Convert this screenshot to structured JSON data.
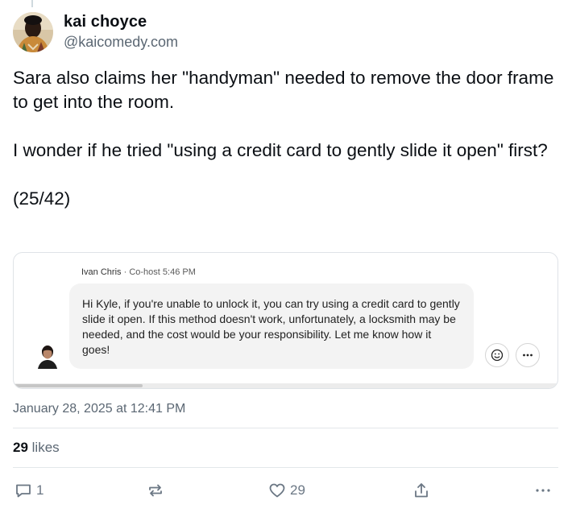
{
  "author": {
    "name": "kai choyce",
    "handle": "@kaicomedy.com"
  },
  "post": {
    "paragraph1": "Sara also claims her \"handyman\" needed to remove the door frame to get into the room.",
    "paragraph2": "I wonder if he tried \"using a credit card to gently slide it open\" first?",
    "paragraph3": "(25/42)"
  },
  "embed": {
    "author": "Ivan Chris",
    "role": "· Co-host",
    "time": "5:46 PM",
    "message": "Hi Kyle, if you're unable to unlock it, you can try using a credit card to gently slide it open. If this method doesn't work, unfortunately, a locksmith may be needed, and the cost would be your responsibility. Let me know how it goes!",
    "icons": [
      "emoji-icon",
      "more-icon"
    ]
  },
  "meta": {
    "timestamp": "January 28, 2025 at 12:41 PM",
    "likes_count": "29",
    "likes_label": "likes"
  },
  "actions": {
    "reply_count": "1",
    "like_count": "29",
    "icons": [
      "reply-icon",
      "repost-icon",
      "heart-icon",
      "share-icon",
      "more-icon"
    ]
  },
  "colors": {
    "text": "#0b0f14",
    "muted": "#5b6773",
    "icon": "#6b7784",
    "bubble": "#f3f3f3",
    "border": "#dfe3e7"
  }
}
